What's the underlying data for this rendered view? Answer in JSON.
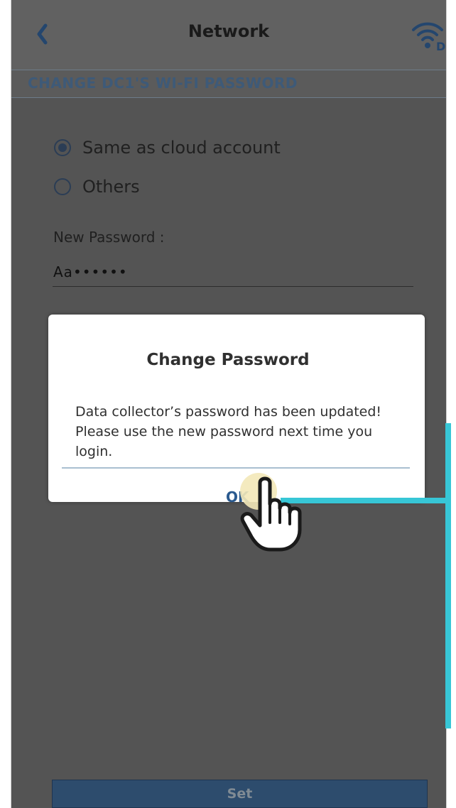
{
  "header": {
    "title": "Network",
    "back_icon": "chevron-left-icon",
    "wifi_icon": "wifi-d-icon"
  },
  "section": {
    "title": "CHANGE DC1'S WI-FI PASSWORD"
  },
  "options": [
    {
      "label": "Same as cloud account",
      "selected": true
    },
    {
      "label": "Others",
      "selected": false
    }
  ],
  "password": {
    "label": "New Password :",
    "value": "Aa••••••"
  },
  "set_button": {
    "label": "Set"
  },
  "dialog": {
    "title": "Change Password",
    "message_line1": "Data collector’s password has been updated!",
    "message_line2": "Please use the new password next time you",
    "message_line3": "login.",
    "ok_label": "OK"
  },
  "colors": {
    "accent": "#37c6d6",
    "brand": "#2d4c6d"
  }
}
